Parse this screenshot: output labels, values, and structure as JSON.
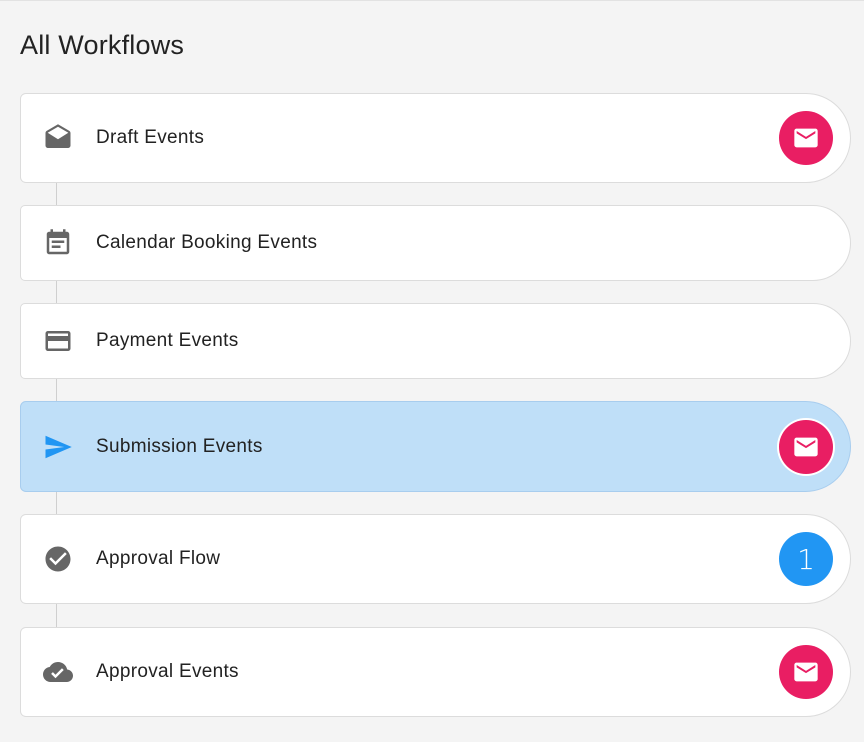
{
  "page": {
    "title": "All Workflows"
  },
  "colors": {
    "accent_pink": "#e91e63",
    "accent_blue": "#2196f3",
    "active_bg": "#bfdff8",
    "icon_gray": "#666666"
  },
  "workflows": [
    {
      "label": "Draft Events",
      "icon": "drafts-icon",
      "badge": "mail",
      "active": false
    },
    {
      "label": "Calendar Booking Events",
      "icon": "calendar-icon",
      "badge": null,
      "active": false
    },
    {
      "label": "Payment Events",
      "icon": "credit-card-icon",
      "badge": null,
      "active": false
    },
    {
      "label": "Submission Events",
      "icon": "send-icon",
      "badge": "mail",
      "active": true
    },
    {
      "label": "Approval Flow",
      "icon": "check-circle-icon",
      "badge": "count",
      "badge_count": "1",
      "active": false
    },
    {
      "label": "Approval Events",
      "icon": "cloud-done-icon",
      "badge": "mail",
      "active": false
    }
  ]
}
